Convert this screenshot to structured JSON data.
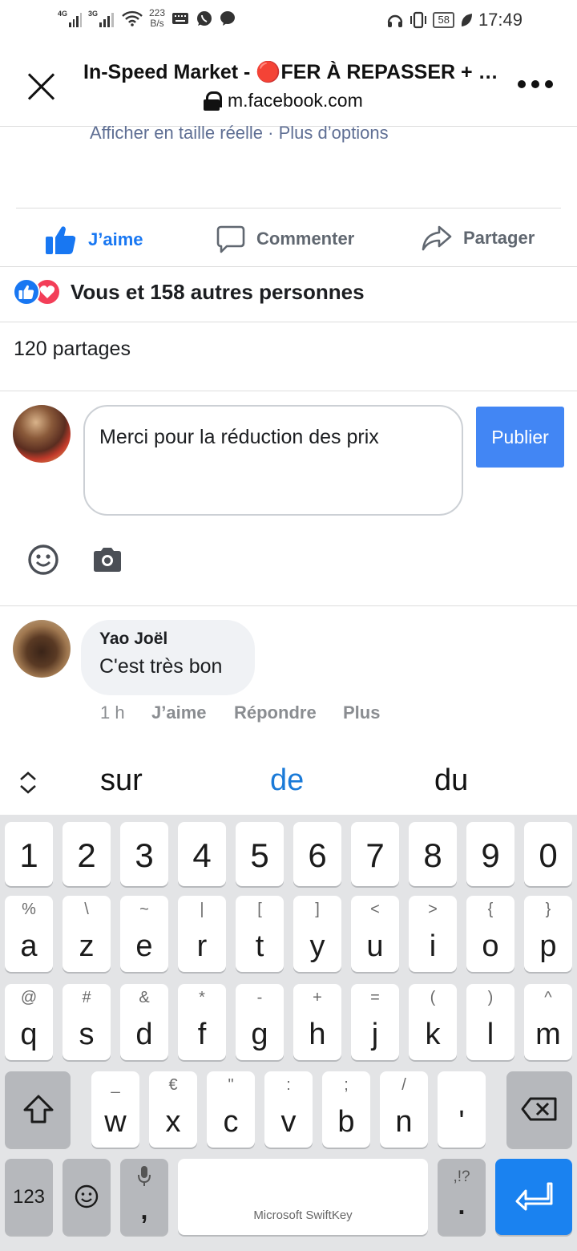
{
  "status_bar": {
    "sig1": "4G",
    "sig2": "3G",
    "net_speed": "223",
    "net_unit": "B/s",
    "battery": "58",
    "time": "17:49"
  },
  "header": {
    "title": "In-Speed Market - 🔴FER À REPASSER + K...",
    "url": "m.facebook.com"
  },
  "photo_links": {
    "full_size": "Afficher en taille réelle",
    "sep": " · ",
    "more_options": "Plus d’options"
  },
  "actions": {
    "like": "J’aime",
    "comment": "Commenter",
    "share": "Partager"
  },
  "reactions_text": "Vous et 158 autres personnes",
  "shares_text": "120 partages",
  "composer": {
    "value": "Merci pour la réduction des prix",
    "publish": "Publier"
  },
  "comment": {
    "author": "Yao Joël",
    "text": "C'est très bon",
    "time": "1 h",
    "like": "J’aime",
    "reply": "Répondre",
    "more": "Plus"
  },
  "suggestions": [
    "sur",
    "de",
    "du"
  ],
  "keyboard": {
    "numbers": [
      "1",
      "2",
      "3",
      "4",
      "5",
      "6",
      "7",
      "8",
      "9",
      "0"
    ],
    "row1": [
      {
        "main": "a",
        "sec": "%"
      },
      {
        "main": "z",
        "sec": "\\"
      },
      {
        "main": "e",
        "sec": "~"
      },
      {
        "main": "r",
        "sec": "|"
      },
      {
        "main": "t",
        "sec": "["
      },
      {
        "main": "y",
        "sec": "]"
      },
      {
        "main": "u",
        "sec": "<"
      },
      {
        "main": "i",
        "sec": ">"
      },
      {
        "main": "o",
        "sec": "{"
      },
      {
        "main": "p",
        "sec": "}"
      }
    ],
    "row2": [
      {
        "main": "q",
        "sec": "@"
      },
      {
        "main": "s",
        "sec": "#"
      },
      {
        "main": "d",
        "sec": "&"
      },
      {
        "main": "f",
        "sec": "*"
      },
      {
        "main": "g",
        "sec": "-"
      },
      {
        "main": "h",
        "sec": "+"
      },
      {
        "main": "j",
        "sec": "="
      },
      {
        "main": "k",
        "sec": "("
      },
      {
        "main": "l",
        "sec": ")"
      },
      {
        "main": "m",
        "sec": "^"
      }
    ],
    "row3": [
      {
        "main": "w",
        "sec": "_"
      },
      {
        "main": "x",
        "sec": "€"
      },
      {
        "main": "c",
        "sec": "\""
      },
      {
        "main": "v",
        "sec": ":"
      },
      {
        "main": "b",
        "sec": ";"
      },
      {
        "main": "n",
        "sec": "/"
      },
      {
        "main": "'",
        "sec": ""
      }
    ],
    "num_key": "123",
    "comma": ",",
    "space_brand": "Microsoft SwiftKey",
    "punct_top": ",!?",
    "period": "."
  },
  "colors": {
    "facebook_blue": "#1877f2",
    "publish_button": "#4286f4",
    "love_red": "#f33e58",
    "suggestion_highlight": "#1a7ad8",
    "enter_key": "#1a82f0"
  }
}
